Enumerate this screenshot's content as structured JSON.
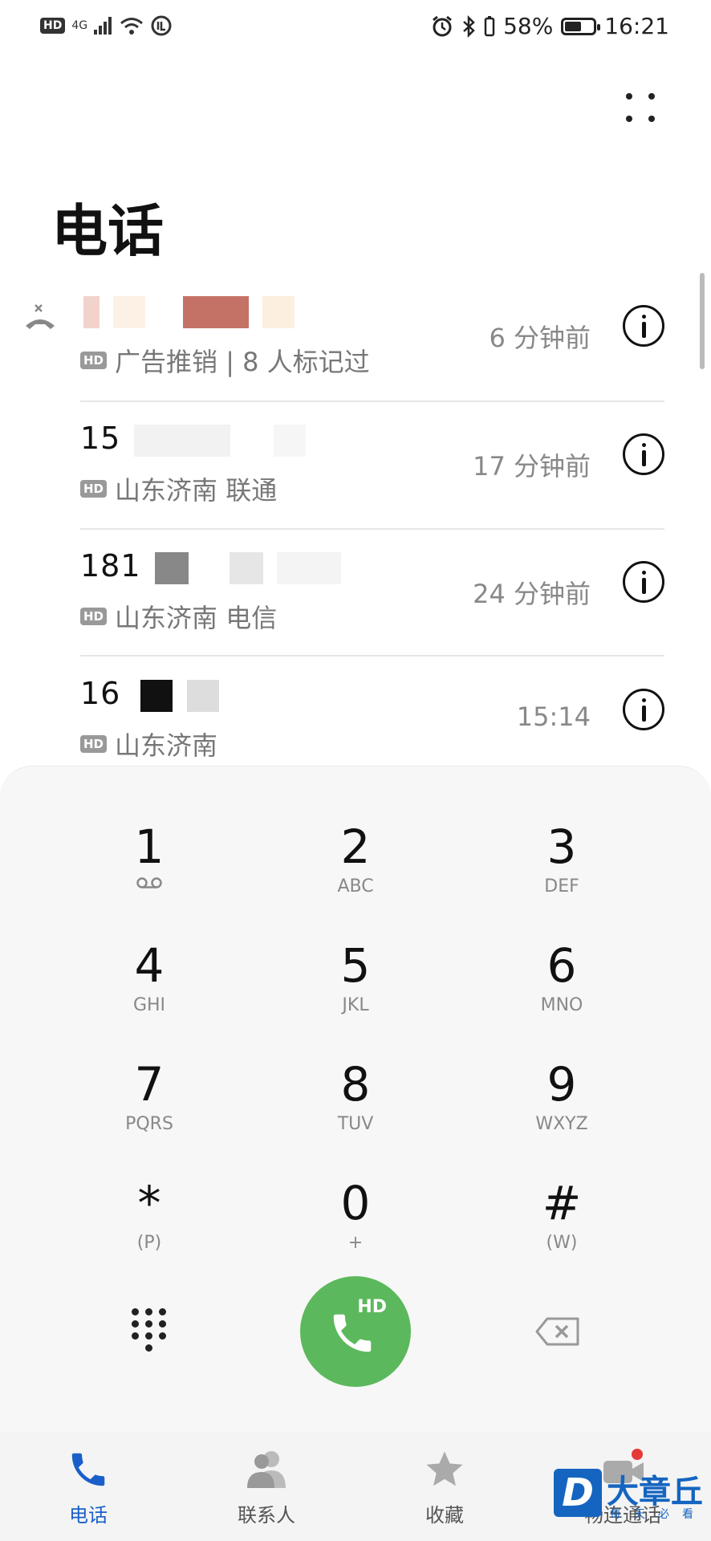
{
  "status_bar": {
    "hd": "HD",
    "network": "4G",
    "battery_percent": "58%",
    "battery_level": 0.58,
    "time": "16:21"
  },
  "page_title": "电话",
  "call_log": [
    {
      "number": "",
      "missed": true,
      "hd": "HD",
      "subtitle": "广告推销 | 8 人标记过",
      "time": "6 分钟前"
    },
    {
      "number": "15",
      "missed": false,
      "hd": "HD",
      "subtitle": "山东济南 联通",
      "time": "17 分钟前"
    },
    {
      "number": "181",
      "missed": false,
      "hd": "HD",
      "subtitle": "山东济南 电信",
      "time": "24 分钟前"
    },
    {
      "number": "16",
      "missed": false,
      "hd": "HD",
      "subtitle": "山东济南",
      "time": "15:14"
    }
  ],
  "dialpad": {
    "keys": [
      {
        "digit": "1",
        "letters": ""
      },
      {
        "digit": "2",
        "letters": "ABC"
      },
      {
        "digit": "3",
        "letters": "DEF"
      },
      {
        "digit": "4",
        "letters": "GHI"
      },
      {
        "digit": "5",
        "letters": "JKL"
      },
      {
        "digit": "6",
        "letters": "MNO"
      },
      {
        "digit": "7",
        "letters": "PQRS"
      },
      {
        "digit": "8",
        "letters": "TUV"
      },
      {
        "digit": "9",
        "letters": "WXYZ"
      },
      {
        "digit": "*",
        "letters": "(P)"
      },
      {
        "digit": "0",
        "letters": "+"
      },
      {
        "digit": "#",
        "letters": "(W)"
      }
    ],
    "call_badge": "HD"
  },
  "tabs": [
    {
      "label": "电话",
      "icon": "phone-icon",
      "active": true
    },
    {
      "label": "联系人",
      "icon": "contacts-icon",
      "active": false
    },
    {
      "label": "收藏",
      "icon": "star-icon",
      "active": false
    },
    {
      "label": "畅连通话",
      "icon": "video-call-icon",
      "active": false
    }
  ],
  "watermark": {
    "letter": "D",
    "title": "大章丘",
    "subtitle": "每天必看"
  },
  "colors": {
    "accent": "#1a5fc9",
    "call_green": "#5cb85c",
    "badge_red": "#e53935"
  }
}
